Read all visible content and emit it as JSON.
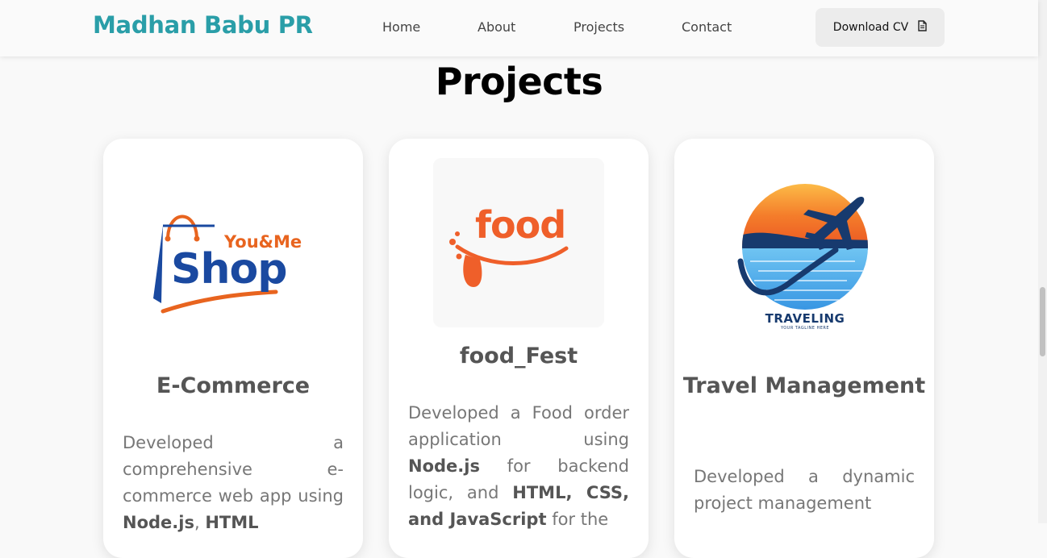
{
  "header": {
    "brand": "Madhan Babu PR",
    "nav": [
      "Home",
      "About",
      "Projects",
      "Contact"
    ],
    "cv_label": "Download CV"
  },
  "page": {
    "title": "Projects"
  },
  "projects": [
    {
      "logo": {
        "top": "You&Me",
        "main": "Shop"
      },
      "title": "E-Commerce",
      "desc": [
        "Developed a comprehensive e-commerce web app using ",
        "Node.js",
        ", ",
        "HTML"
      ]
    },
    {
      "logo": {
        "main": "food"
      },
      "title": "food_Fest",
      "desc": [
        "Developed a Food order application using ",
        "Node.js",
        " for backend logic, and ",
        "HTML, CSS, and JavaScript",
        " for the"
      ]
    },
    {
      "logo": {
        "main": "TRAVELING",
        "tagline": "YOUR TAGLINE HERE"
      },
      "title": "Travel Management",
      "desc": [
        "Developed a dynamic project management"
      ]
    }
  ],
  "colors": {
    "brand": "#2a9ea8",
    "shop_blue": "#1a49a0",
    "shop_orange": "#e8641f",
    "food_orange": "#ef5f2a"
  },
  "icons": {
    "cv": "document-icon"
  }
}
